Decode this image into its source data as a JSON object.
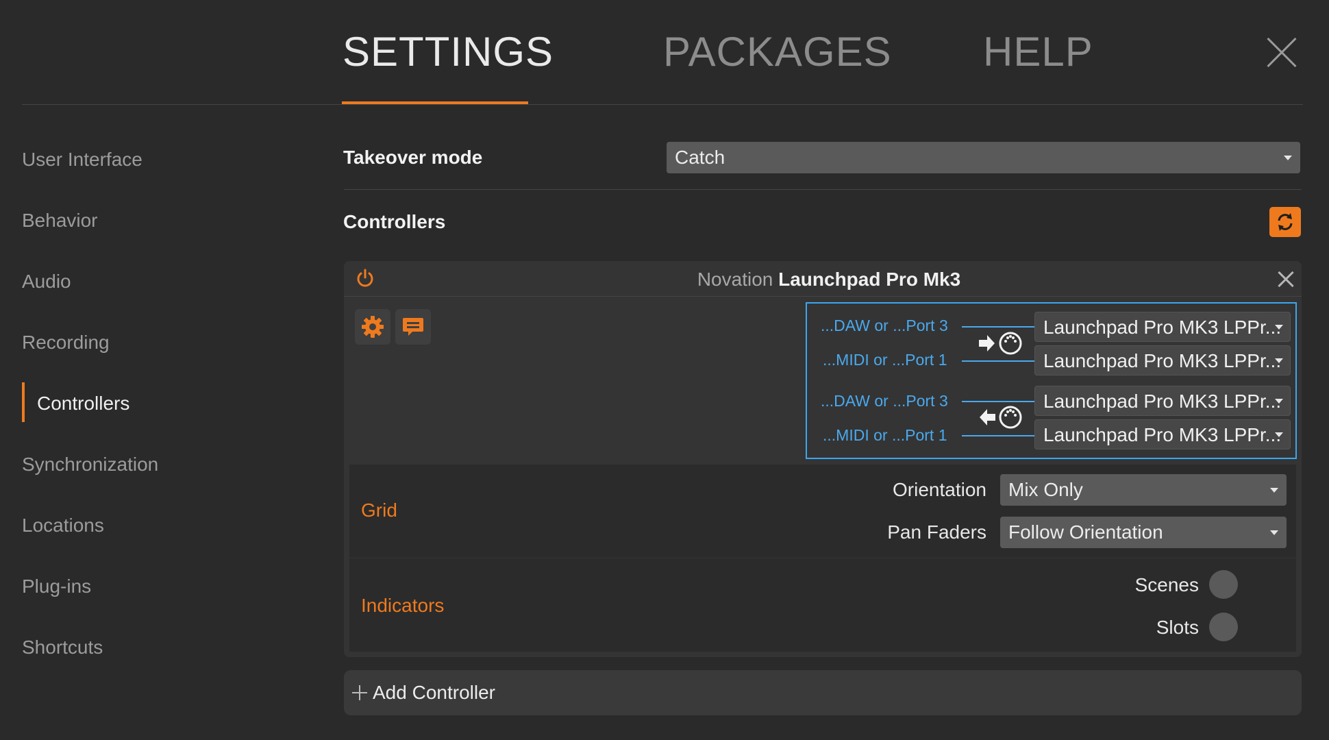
{
  "tabs": [
    {
      "label": "SETTINGS",
      "active": true
    },
    {
      "label": "PACKAGES",
      "active": false
    },
    {
      "label": "HELP",
      "active": false
    }
  ],
  "sidebar": {
    "items": [
      {
        "label": "User Interface"
      },
      {
        "label": "Behavior"
      },
      {
        "label": "Audio"
      },
      {
        "label": "Recording"
      },
      {
        "label": "Controllers",
        "active": true
      },
      {
        "label": "Synchronization"
      },
      {
        "label": "Locations"
      },
      {
        "label": "Plug-ins"
      },
      {
        "label": "Shortcuts"
      }
    ]
  },
  "takeover": {
    "label": "Takeover mode",
    "value": "Catch"
  },
  "controllers": {
    "label": "Controllers",
    "device": {
      "vendor": "Novation",
      "model": "Launchpad Pro Mk3",
      "inputs": [
        {
          "port": "...DAW or ...Port 3",
          "device": "Launchpad Pro MK3 LPPr..."
        },
        {
          "port": "...MIDI or ...Port 1",
          "device": "Launchpad Pro MK3 LPPr..."
        }
      ],
      "outputs": [
        {
          "port": "...DAW or ...Port 3",
          "device": "Launchpad Pro MK3 LPPr..."
        },
        {
          "port": "...MIDI or ...Port 1",
          "device": "Launchpad Pro MK3 LPPr..."
        }
      ],
      "grid": {
        "title": "Grid",
        "orientation_label": "Orientation",
        "orientation_value": "Mix Only",
        "pan_faders_label": "Pan Faders",
        "pan_faders_value": "Follow Orientation"
      },
      "indicators": {
        "title": "Indicators",
        "scenes_label": "Scenes",
        "slots_label": "Slots"
      }
    },
    "add_label": "Add Controller"
  },
  "colors": {
    "accent": "#ef7a1e",
    "port_blue": "#3aa7f0"
  }
}
